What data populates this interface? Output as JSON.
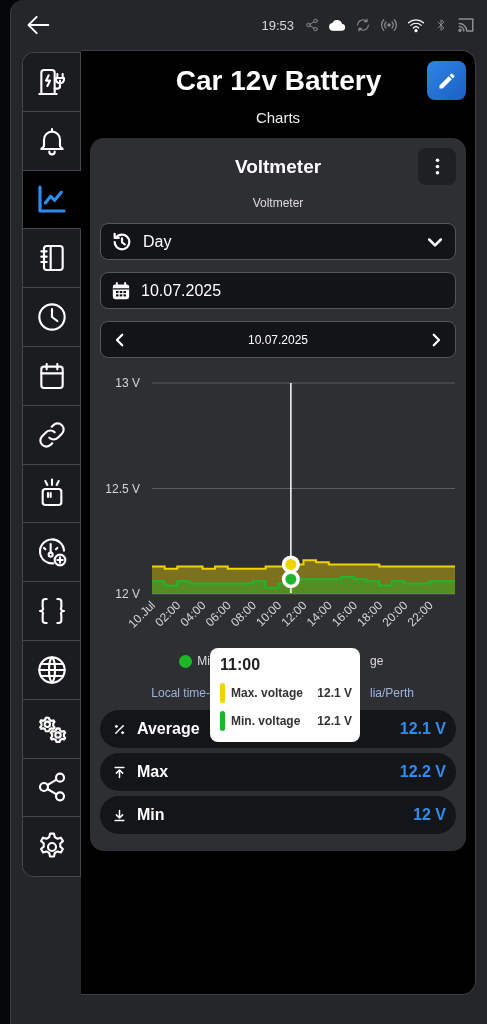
{
  "status_bar": {
    "time": "19:53"
  },
  "sidebar": {
    "items": [
      {
        "selected": false
      },
      {
        "selected": false
      },
      {
        "selected": true
      },
      {
        "selected": false
      },
      {
        "selected": false
      },
      {
        "selected": false
      },
      {
        "selected": false
      },
      {
        "selected": false
      },
      {
        "selected": false
      },
      {
        "selected": false
      },
      {
        "selected": false
      },
      {
        "selected": false
      },
      {
        "selected": false
      },
      {
        "selected": false
      }
    ]
  },
  "header": {
    "title": "Car 12v Battery",
    "subtitle": "Charts"
  },
  "card": {
    "title": "Voltmeter",
    "subtitle": "Voltmeter",
    "period_select": {
      "value": "Day"
    },
    "date_field": {
      "value": "10.07.2025"
    },
    "date_nav": {
      "label": "10.07.2025"
    },
    "chart_data": {
      "type": "area",
      "x": [
        0,
        1,
        1,
        2,
        2,
        3,
        3,
        4,
        4,
        5,
        5,
        6,
        6,
        7,
        7,
        8,
        8,
        9,
        9,
        10,
        10,
        11,
        11,
        12,
        12,
        13,
        13,
        14,
        14,
        15,
        15,
        16,
        16,
        17,
        17,
        18,
        18,
        19,
        19,
        20,
        20,
        21,
        21,
        22,
        22,
        23,
        23,
        24
      ],
      "series": [
        {
          "name": "Max. voltage",
          "color": "#f0d400",
          "values": [
            12.13,
            12.13,
            12.12,
            12.12,
            12.13,
            12.13,
            12.13,
            12.13,
            12.12,
            12.12,
            12.13,
            12.13,
            12.12,
            12.12,
            12.12,
            12.12,
            12.12,
            12.12,
            12.13,
            12.13,
            12.13,
            12.13,
            12.14,
            12.14,
            12.16,
            12.16,
            12.15,
            12.15,
            12.14,
            12.14,
            12.14,
            12.14,
            12.14,
            12.14,
            12.14,
            12.14,
            12.13,
            12.13,
            12.13,
            12.13,
            12.13,
            12.13,
            12.13,
            12.13,
            12.13,
            12.13,
            12.13,
            12.13
          ]
        },
        {
          "name": "Min. voltage",
          "color": "#1db82a",
          "values": [
            12.06,
            12.06,
            12.04,
            12.04,
            12.06,
            12.06,
            12.05,
            12.05,
            12.05,
            12.05,
            12.05,
            12.05,
            12.05,
            12.05,
            12.05,
            12.05,
            12.06,
            12.06,
            12.03,
            12.03,
            12.05,
            12.05,
            12.07,
            12.07,
            12.07,
            12.07,
            12.07,
            12.07,
            12.07,
            12.07,
            12.08,
            12.08,
            12.07,
            12.07,
            12.06,
            12.06,
            12.04,
            12.04,
            12.06,
            12.06,
            12.05,
            12.05,
            12.05,
            12.05,
            12.06,
            12.06,
            12.06,
            12.06
          ]
        }
      ],
      "xlim": [
        0,
        24
      ],
      "ylim": [
        12,
        13
      ],
      "xticks": [
        {
          "value": 0,
          "label": "10.Jul"
        },
        {
          "value": 2,
          "label": "02:00"
        },
        {
          "value": 4,
          "label": "04:00"
        },
        {
          "value": 6,
          "label": "06:00"
        },
        {
          "value": 8,
          "label": "08:00"
        },
        {
          "value": 10,
          "label": "10:00"
        },
        {
          "value": 12,
          "label": "12:00"
        },
        {
          "value": 14,
          "label": "14:00"
        },
        {
          "value": 16,
          "label": "16:00"
        },
        {
          "value": 18,
          "label": "18:00"
        },
        {
          "value": 20,
          "label": "20:00"
        },
        {
          "value": 22,
          "label": "22:00"
        }
      ],
      "yticks": [
        {
          "value": 12,
          "label": "12 V"
        },
        {
          "value": 12.5,
          "label": "12.5 V"
        },
        {
          "value": 13,
          "label": "13 V"
        }
      ],
      "ref_lines": [
        {
          "axis": "x",
          "value": 11,
          "color": "#ffffff"
        }
      ]
    },
    "legend": {
      "left": {
        "text": "Mi",
        "color": "#1db82a"
      },
      "right": {
        "text": "ge"
      }
    },
    "timezone": {
      "left": "Local time-",
      "right": "lia/Perth"
    },
    "tooltip": {
      "title": "11:00",
      "values": [
        "12.1 V",
        "12.1 V"
      ]
    },
    "stats": [
      {
        "kind": "average",
        "label": "Average",
        "value": "12.1 V"
      },
      {
        "kind": "max",
        "label": "Max",
        "value": "12.2 V"
      },
      {
        "kind": "min",
        "label": "Min",
        "value": "12 V"
      }
    ]
  }
}
